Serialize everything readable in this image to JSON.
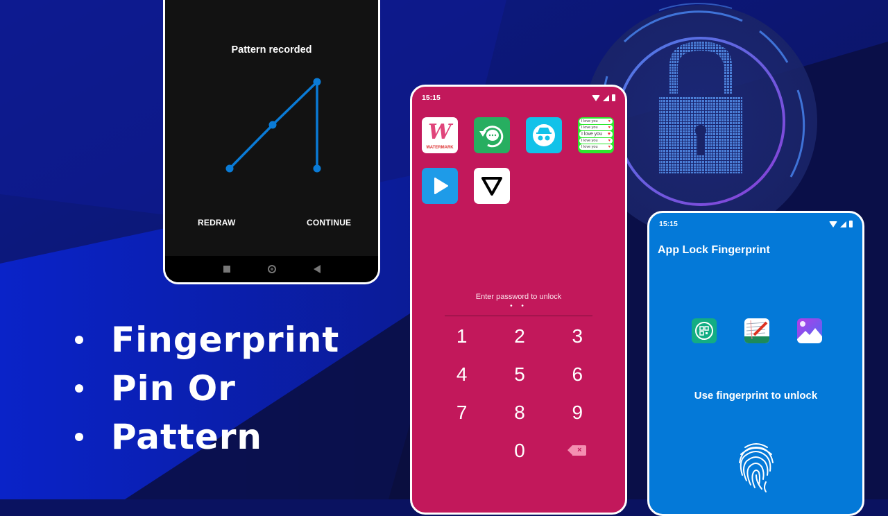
{
  "features": [
    "Fingerprint",
    "Pin Or",
    "Pattern"
  ],
  "pattern_screen": {
    "title": "Pattern recorded",
    "redraw_label": "REDRAW",
    "continue_label": "CONTINUE",
    "pattern_sequence": [
      7,
      5,
      3,
      9
    ],
    "line_color": "#0a7bd6"
  },
  "pin_screen": {
    "status_time": "15:15",
    "background_color": "#c2185b",
    "apps": [
      {
        "name": "WaterMark",
        "icon": "watermark-app-icon"
      },
      {
        "name": "Message Restore",
        "icon": "restore-chat-app-icon"
      },
      {
        "name": "Incognito Chat",
        "icon": "incognito-app-icon"
      },
      {
        "name": "Love Messages",
        "icon": "love-messages-app-icon"
      },
      {
        "name": "Video Player",
        "icon": "play-app-icon"
      },
      {
        "name": "Vee",
        "icon": "triangle-app-icon"
      }
    ],
    "watermark_icon_text": "W",
    "watermark_icon_label": "WATERMARK",
    "love_text": "I love you",
    "prompt": "Enter password to unlock",
    "entered_dots": "• •",
    "keys": [
      "1",
      "2",
      "3",
      "4",
      "5",
      "6",
      "7",
      "8",
      "9",
      "",
      "0",
      "⌫"
    ]
  },
  "fingerprint_screen": {
    "status_time": "15:15",
    "background_color": "#0479d8",
    "title": "App Lock Fingerprint",
    "apps": [
      {
        "name": "QR Scanner",
        "icon": "qr-scanner-app-icon"
      },
      {
        "name": "Notes",
        "icon": "notes-app-icon"
      },
      {
        "name": "Gallery",
        "icon": "gallery-app-icon"
      }
    ],
    "message": "Use fingerprint to unlock"
  }
}
